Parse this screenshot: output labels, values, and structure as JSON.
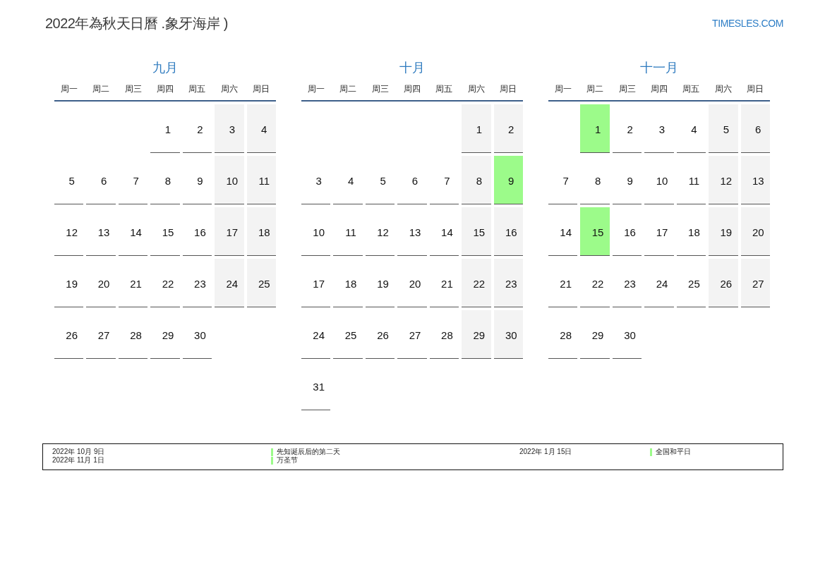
{
  "header": {
    "title": "2022年為秋天日曆 .象牙海岸 )",
    "site": "TIMESLES.COM"
  },
  "months": [
    {
      "title": "九月",
      "weekdays": [
        "周一",
        "周二",
        "周三",
        "周四",
        "周五",
        "周六",
        "周日"
      ],
      "weeks": [
        [
          {
            "kind": "empty"
          },
          {
            "kind": "empty"
          },
          {
            "kind": "empty"
          },
          {
            "day": "1",
            "kind": "weekday"
          },
          {
            "day": "2",
            "kind": "weekday"
          },
          {
            "day": "3",
            "kind": "weekend"
          },
          {
            "day": "4",
            "kind": "weekend"
          }
        ],
        [
          {
            "day": "5",
            "kind": "weekday"
          },
          {
            "day": "6",
            "kind": "weekday"
          },
          {
            "day": "7",
            "kind": "weekday"
          },
          {
            "day": "8",
            "kind": "weekday"
          },
          {
            "day": "9",
            "kind": "weekday"
          },
          {
            "day": "10",
            "kind": "weekend"
          },
          {
            "day": "11",
            "kind": "weekend"
          }
        ],
        [
          {
            "day": "12",
            "kind": "weekday"
          },
          {
            "day": "13",
            "kind": "weekday"
          },
          {
            "day": "14",
            "kind": "weekday"
          },
          {
            "day": "15",
            "kind": "weekday"
          },
          {
            "day": "16",
            "kind": "weekday"
          },
          {
            "day": "17",
            "kind": "weekend"
          },
          {
            "day": "18",
            "kind": "weekend"
          }
        ],
        [
          {
            "day": "19",
            "kind": "weekday"
          },
          {
            "day": "20",
            "kind": "weekday"
          },
          {
            "day": "21",
            "kind": "weekday"
          },
          {
            "day": "22",
            "kind": "weekday"
          },
          {
            "day": "23",
            "kind": "weekday"
          },
          {
            "day": "24",
            "kind": "weekend"
          },
          {
            "day": "25",
            "kind": "weekend"
          }
        ],
        [
          {
            "day": "26",
            "kind": "weekday"
          },
          {
            "day": "27",
            "kind": "weekday"
          },
          {
            "day": "28",
            "kind": "weekday"
          },
          {
            "day": "29",
            "kind": "weekday"
          },
          {
            "day": "30",
            "kind": "weekday"
          }
        ]
      ]
    },
    {
      "title": "十月",
      "weekdays": [
        "周一",
        "周二",
        "周三",
        "周四",
        "周五",
        "周六",
        "周日"
      ],
      "weeks": [
        [
          {
            "kind": "empty"
          },
          {
            "kind": "empty"
          },
          {
            "kind": "empty"
          },
          {
            "kind": "empty"
          },
          {
            "kind": "empty"
          },
          {
            "day": "1",
            "kind": "weekend"
          },
          {
            "day": "2",
            "kind": "weekend"
          }
        ],
        [
          {
            "day": "3",
            "kind": "weekday"
          },
          {
            "day": "4",
            "kind": "weekday"
          },
          {
            "day": "5",
            "kind": "weekday"
          },
          {
            "day": "6",
            "kind": "weekday"
          },
          {
            "day": "7",
            "kind": "weekday"
          },
          {
            "day": "8",
            "kind": "weekend"
          },
          {
            "day": "9",
            "kind": "holiday"
          }
        ],
        [
          {
            "day": "10",
            "kind": "weekday"
          },
          {
            "day": "11",
            "kind": "weekday"
          },
          {
            "day": "12",
            "kind": "weekday"
          },
          {
            "day": "13",
            "kind": "weekday"
          },
          {
            "day": "14",
            "kind": "weekday"
          },
          {
            "day": "15",
            "kind": "weekend"
          },
          {
            "day": "16",
            "kind": "weekend"
          }
        ],
        [
          {
            "day": "17",
            "kind": "weekday"
          },
          {
            "day": "18",
            "kind": "weekday"
          },
          {
            "day": "19",
            "kind": "weekday"
          },
          {
            "day": "20",
            "kind": "weekday"
          },
          {
            "day": "21",
            "kind": "weekday"
          },
          {
            "day": "22",
            "kind": "weekend"
          },
          {
            "day": "23",
            "kind": "weekend"
          }
        ],
        [
          {
            "day": "24",
            "kind": "weekday"
          },
          {
            "day": "25",
            "kind": "weekday"
          },
          {
            "day": "26",
            "kind": "weekday"
          },
          {
            "day": "27",
            "kind": "weekday"
          },
          {
            "day": "28",
            "kind": "weekday"
          },
          {
            "day": "29",
            "kind": "weekend"
          },
          {
            "day": "30",
            "kind": "weekend"
          }
        ],
        [
          {
            "day": "31",
            "kind": "weekday"
          }
        ]
      ]
    },
    {
      "title": "十一月",
      "weekdays": [
        "周一",
        "周二",
        "周三",
        "周四",
        "周五",
        "周六",
        "周日"
      ],
      "weeks": [
        [
          {
            "kind": "empty"
          },
          {
            "day": "1",
            "kind": "holiday"
          },
          {
            "day": "2",
            "kind": "weekday"
          },
          {
            "day": "3",
            "kind": "weekday"
          },
          {
            "day": "4",
            "kind": "weekday"
          },
          {
            "day": "5",
            "kind": "weekend"
          },
          {
            "day": "6",
            "kind": "weekend"
          }
        ],
        [
          {
            "day": "7",
            "kind": "weekday"
          },
          {
            "day": "8",
            "kind": "weekday"
          },
          {
            "day": "9",
            "kind": "weekday"
          },
          {
            "day": "10",
            "kind": "weekday"
          },
          {
            "day": "11",
            "kind": "weekday"
          },
          {
            "day": "12",
            "kind": "weekend"
          },
          {
            "day": "13",
            "kind": "weekend"
          }
        ],
        [
          {
            "day": "14",
            "kind": "weekday"
          },
          {
            "day": "15",
            "kind": "holiday"
          },
          {
            "day": "16",
            "kind": "weekday"
          },
          {
            "day": "17",
            "kind": "weekday"
          },
          {
            "day": "18",
            "kind": "weekday"
          },
          {
            "day": "19",
            "kind": "weekend"
          },
          {
            "day": "20",
            "kind": "weekend"
          }
        ],
        [
          {
            "day": "21",
            "kind": "weekday"
          },
          {
            "day": "22",
            "kind": "weekday"
          },
          {
            "day": "23",
            "kind": "weekday"
          },
          {
            "day": "24",
            "kind": "weekday"
          },
          {
            "day": "25",
            "kind": "weekday"
          },
          {
            "day": "26",
            "kind": "weekend"
          },
          {
            "day": "27",
            "kind": "weekend"
          }
        ],
        [
          {
            "day": "28",
            "kind": "weekday"
          },
          {
            "day": "29",
            "kind": "weekday"
          },
          {
            "day": "30",
            "kind": "weekday"
          }
        ]
      ]
    }
  ],
  "legend": {
    "columns": [
      [
        {
          "date": "2022年 10月 9日",
          "name": "先知诞辰后的第二天"
        },
        {
          "date": "2022年 11月 1日",
          "name": "万圣节"
        }
      ],
      [
        {
          "date": "2022年 1月 15日",
          "name": "全国和平日"
        }
      ]
    ]
  }
}
